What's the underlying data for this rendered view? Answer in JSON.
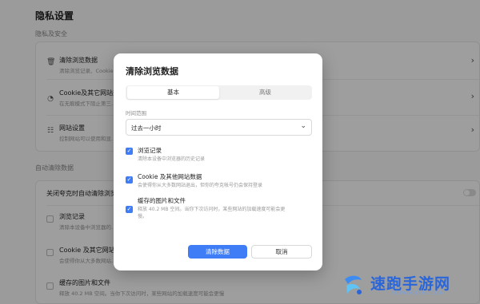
{
  "settings": {
    "title": "隐私设置",
    "section_privacy": "隐私及安全",
    "rows": [
      {
        "title": "清除浏览数据",
        "desc": "清除浏览记录、Cookie…"
      },
      {
        "title": "Cookie及其它网站数",
        "desc": "在无痕模式下阻止第三…"
      },
      {
        "title": "网站设置",
        "desc": "控制网站可以使用和显…"
      }
    ],
    "section_auto": "自动清除数据",
    "auto_row": "关闭夸克时自动清除浏览",
    "auto_items": [
      {
        "title": "浏览记录",
        "desc": "清除本设备中浏览器的…"
      },
      {
        "title": "Cookie 及其它网站数",
        "desc": "会使得你从大多数网站…"
      },
      {
        "title": "缓存的图片和文件",
        "desc": "释放 40.2 MB 空间。当你下次访问时，某些网站的加载速度可能会更慢"
      }
    ]
  },
  "dialog": {
    "title": "清除浏览数据",
    "tabs": [
      "基本",
      "高级"
    ],
    "time_range_label": "时间范围",
    "time_range_value": "过去一小时",
    "options": [
      {
        "title": "浏览记录",
        "desc": "清除本设备中浏览器的历史记录",
        "checked": true
      },
      {
        "title": "Cookie 及其他网站数据",
        "desc": "会使得你从大多数网站退出，但你的夸克帐号仍会保持登录",
        "checked": true
      },
      {
        "title": "缓存的图片和文件",
        "desc": "释放 40.2 MB 空间。当你下次访问时，某些网站的加载速度可能会更",
        "desc2": "慢。",
        "checked": true
      }
    ],
    "confirm_label": "清除数据",
    "cancel_label": "取消"
  },
  "watermark": {
    "text": "速跑手游网",
    "sub": "SUPAOQISHI.COM"
  },
  "colors": {
    "accent": "#3f7df6",
    "overlay": "rgba(0,0,0,0.38)"
  },
  "icons": {
    "clear": "trash-icon",
    "cookie": "cookie-icon",
    "site": "sliders-icon",
    "caret": "chevron-down-icon",
    "check": "checkmark-icon"
  }
}
